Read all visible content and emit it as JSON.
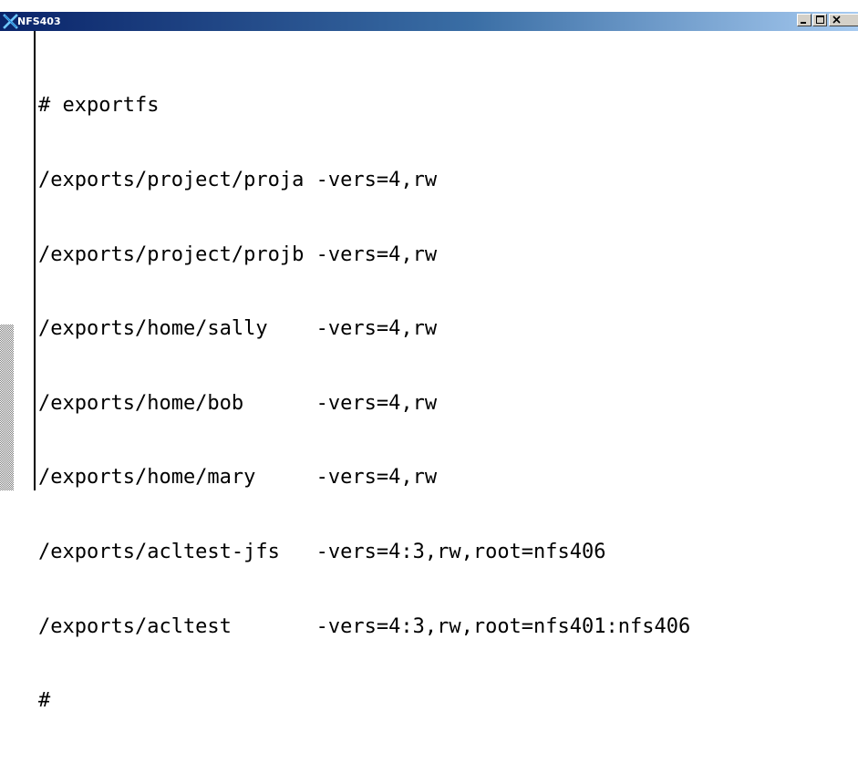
{
  "window": {
    "title": "NFS403",
    "icon": "x-logo-icon",
    "controls": [
      "minimize-icon",
      "maximize-icon",
      "close-icon"
    ]
  },
  "terminal": {
    "lines": [
      "# exportfs",
      "/exports/project/proja -vers=4,rw",
      "/exports/project/projb -vers=4,rw",
      "/exports/home/sally    -vers=4,rw",
      "/exports/home/bob      -vers=4,rw",
      "/exports/home/mary     -vers=4,rw",
      "/exports/acltest-jfs   -vers=4:3,rw,root=nfs406",
      "/exports/acltest       -vers=4:3,rw,root=nfs401:nfs406",
      "#"
    ]
  },
  "colors": {
    "titlebar_start": "#0a246a",
    "titlebar_end": "#a6caf0",
    "background": "#ffffff",
    "text": "#000000"
  }
}
